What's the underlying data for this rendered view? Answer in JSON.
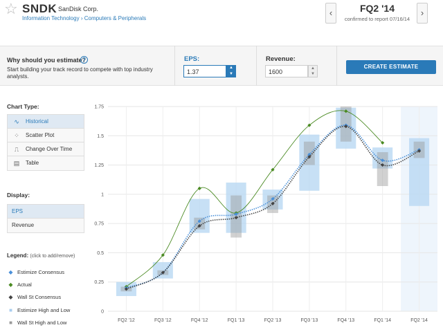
{
  "header": {
    "ticker": "SNDK",
    "company": "SanDisk Corp.",
    "sector": "Information Technology",
    "breadcrumb_sep": "›",
    "industry": "Computers & Peripherals",
    "quarter": "FQ2 '14",
    "confirmed": "confirmed to report 07/16/14",
    "prev_glyph": "‹",
    "next_glyph": "›",
    "star_glyph": "☆"
  },
  "estimate": {
    "question": "Why should you estimate?",
    "help_glyph": "?",
    "description": "Start building your track record to compete with top industry analysts.",
    "eps_label": "EPS:",
    "eps_value": "1.37",
    "revenue_label": "Revenue:",
    "revenue_value": "1600",
    "create_label": "CREATE ESTIMATE",
    "up_glyph": "▲",
    "down_glyph": "▼"
  },
  "sidebar": {
    "chart_type_label": "Chart Type:",
    "chart_types": [
      {
        "label": "Historical",
        "icon": "wave-icon",
        "glyph": "∿",
        "active": true
      },
      {
        "label": "Scatter Plot",
        "icon": "scatter-icon",
        "glyph": "⁘",
        "active": false
      },
      {
        "label": "Change Over Time",
        "icon": "step-icon",
        "glyph": "⎍",
        "active": false
      },
      {
        "label": "Table",
        "icon": "table-icon",
        "glyph": "▤",
        "active": false
      }
    ],
    "display_label": "Display:",
    "display_items": [
      {
        "label": "EPS",
        "active": true
      },
      {
        "label": "Revenue",
        "active": false
      }
    ],
    "legend_title": "Legend:",
    "legend_hint": "(click to add/remove)",
    "legend": [
      {
        "label": "Estimize Consensus",
        "glyph": "◆",
        "color": "#4a90d9"
      },
      {
        "label": "Actual",
        "glyph": "◆",
        "color": "#4a8a22"
      },
      {
        "label": "Wall St Consensus",
        "glyph": "◆",
        "color": "#444444"
      },
      {
        "label": "Estimize High and Low",
        "glyph": "■",
        "color": "#a9cdef"
      },
      {
        "label": "Wall St High and Low",
        "glyph": "■",
        "color": "#999999"
      }
    ]
  },
  "colors": {
    "accent": "#2a7ab8",
    "actual": "#4a8a22",
    "estimize": "#4a90d9",
    "wallst": "#444444",
    "estimize_range": "#b9d8f3",
    "wallst_range": "#9a9a9a"
  },
  "chart_data": {
    "type": "line",
    "categories": [
      "FQ2 '12",
      "FQ3 '12",
      "FQ4 '12",
      "FQ1 '13",
      "FQ2 '13",
      "FQ3 '13",
      "FQ4 '13",
      "FQ1 '14",
      "FQ2 '14"
    ],
    "ylim": [
      0,
      1.75
    ],
    "yticks": [
      "0",
      "0.25",
      "0.5",
      "0.75",
      "1",
      "1.25",
      "1.5",
      "1.75"
    ],
    "grid": true,
    "series": [
      {
        "name": "Actual",
        "values": [
          0.21,
          0.48,
          1.05,
          0.84,
          1.21,
          1.59,
          1.71,
          1.44,
          null
        ]
      },
      {
        "name": "Estimize Consensus",
        "values": [
          0.2,
          0.33,
          0.77,
          0.83,
          0.96,
          1.34,
          1.59,
          1.29,
          1.38
        ]
      },
      {
        "name": "Wall St Consensus",
        "values": [
          0.19,
          0.33,
          0.73,
          0.8,
          0.92,
          1.32,
          1.58,
          1.25,
          1.37
        ]
      }
    ],
    "estimize_high_low": [
      [
        0.13,
        0.25
      ],
      [
        0.28,
        0.42
      ],
      [
        0.67,
        0.96
      ],
      [
        0.67,
        1.1
      ],
      [
        0.87,
        1.04
      ],
      [
        1.03,
        1.51
      ],
      [
        1.39,
        1.74
      ],
      [
        1.22,
        1.4
      ],
      [
        0.9,
        1.48
      ]
    ],
    "wallst_high_low": [
      [
        0.17,
        0.21
      ],
      [
        0.31,
        0.35
      ],
      [
        0.7,
        0.8
      ],
      [
        0.63,
        0.99
      ],
      [
        0.84,
        0.99
      ],
      [
        1.25,
        1.45
      ],
      [
        1.45,
        1.75
      ],
      [
        1.07,
        1.36
      ],
      [
        1.31,
        1.45
      ]
    ]
  }
}
